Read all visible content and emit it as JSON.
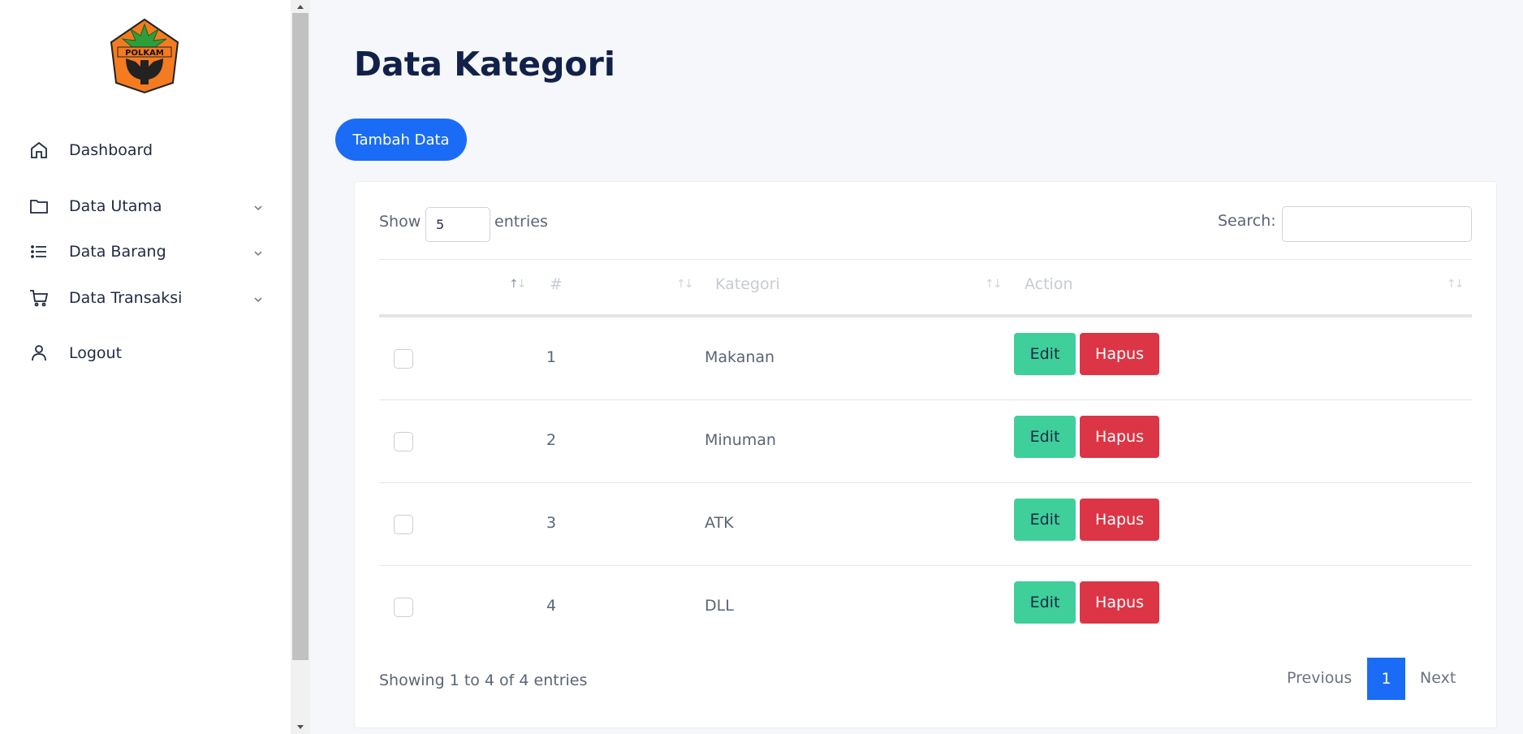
{
  "sidebar": {
    "logo_text": "POLKAM",
    "items": [
      {
        "label": "Dashboard",
        "icon": "home-icon"
      },
      {
        "label": "Data Utama",
        "icon": "folder-icon"
      },
      {
        "label": "Data Barang",
        "icon": "list-icon"
      },
      {
        "label": "Data Transaksi",
        "icon": "cart-icon"
      },
      {
        "label": "Logout",
        "icon": "user-icon"
      }
    ]
  },
  "main": {
    "title": "Data Kategori",
    "add_button": "Tambah Data",
    "table": {
      "show_label": "Show",
      "entries_value": "5",
      "entries_label": "entries",
      "search_label": "Search:",
      "search_value": "",
      "columns": [
        "",
        "#",
        "Kategori",
        "Action"
      ],
      "rows": [
        {
          "no": "1",
          "kategori": "Makanan",
          "edit": "Edit",
          "hapus": "Hapus"
        },
        {
          "no": "2",
          "kategori": "Minuman",
          "edit": "Edit",
          "hapus": "Hapus"
        },
        {
          "no": "3",
          "kategori": "ATK",
          "edit": "Edit",
          "hapus": "Hapus"
        },
        {
          "no": "4",
          "kategori": "DLL",
          "edit": "Edit",
          "hapus": "Hapus"
        }
      ],
      "info": "Showing 1 to 4 of 4 entries",
      "pagination": {
        "previous": "Previous",
        "current": "1",
        "next": "Next"
      }
    }
  },
  "colors": {
    "primary": "#1a6cf6",
    "success": "#3ecf9a",
    "danger": "#dc3545",
    "title": "#12214a"
  }
}
